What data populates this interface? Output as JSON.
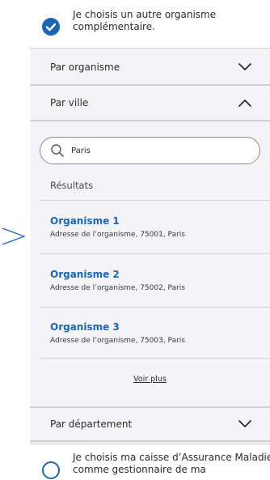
{
  "options": {
    "top": {
      "label": "Je choisis un autre organisme complémentaire.",
      "checked": true
    },
    "bottom": {
      "label_line1": "Je choisis ma caisse d’Assurance Maladie",
      "label_line2": "comme gestionnaire de ma",
      "checked": false
    }
  },
  "accordions": {
    "par_organisme": {
      "label": "Par organisme",
      "expanded": false
    },
    "par_ville": {
      "label": "Par ville",
      "expanded": true
    },
    "par_departement": {
      "label": "Par département",
      "expanded": false
    }
  },
  "search": {
    "value": "Paris",
    "placeholder": ""
  },
  "results": {
    "label": "Résultats",
    "items": [
      {
        "name": "Organisme 1",
        "address": "Adresse de l’organisme, 75001, Paris"
      },
      {
        "name": "Organisme 2",
        "address": "Adresse de l’organisme, 75002, Paris"
      },
      {
        "name": "Organisme 3",
        "address": "Adresse de l’organisme, 75003, Paris"
      }
    ],
    "more_label": "Voir plus"
  },
  "colors": {
    "accent": "#1c66b1",
    "panel_bg": "#f4f4f6",
    "divider": "#cfd0d4",
    "annotation_arrow": "#1c66b1"
  },
  "icons": {
    "check": "check-icon",
    "chevron_down": "chevron-down-icon",
    "chevron_up": "chevron-up-icon",
    "search": "search-icon",
    "annotation_arrow": "arrow-right-icon"
  }
}
